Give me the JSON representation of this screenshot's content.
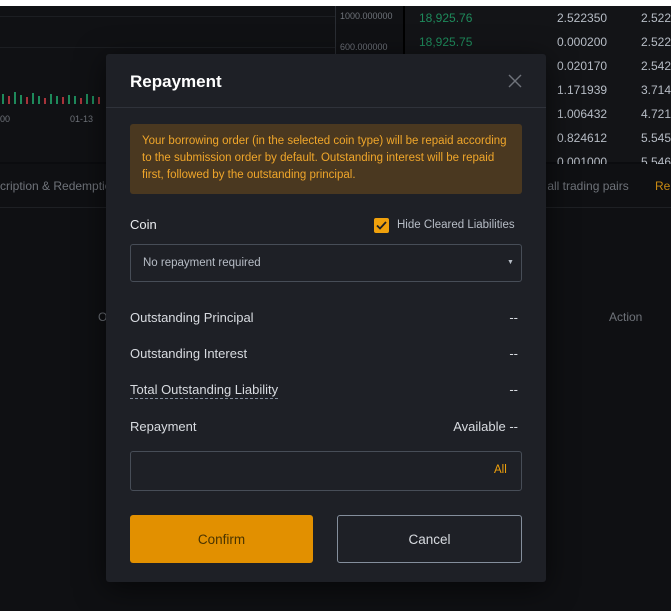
{
  "background": {
    "chart": {
      "y_ticks": [
        "1000.000000",
        "600.000000"
      ],
      "x_ticks": [
        "00",
        "01-13"
      ]
    },
    "orderbook": {
      "rows": [
        {
          "price": "18,925.76",
          "amount": "2.522350",
          "total": "2.522"
        },
        {
          "price": "18,925.75",
          "amount": "0.000200",
          "total": "2.522"
        },
        {
          "price": "",
          "amount": "0.020170",
          "total": "2.542"
        },
        {
          "price": "",
          "amount": "1.171939",
          "total": "3.714"
        },
        {
          "price": "",
          "amount": "1.006432",
          "total": "4.721"
        },
        {
          "price": "",
          "amount": "0.824612",
          "total": "5.545"
        },
        {
          "price": "",
          "amount": "0.001000",
          "total": "5.546"
        }
      ]
    },
    "tabs_left": "cription & Redemptio",
    "tabs_right": "v all trading pairs",
    "tabs_right_accent": "Re",
    "column_left": "O",
    "column_action": "Action"
  },
  "modal": {
    "title": "Repayment",
    "notice": "Your borrowing order (in the selected coin type) will be repaid according to the submission order by default. Outstanding interest will be repaid first, followed by the outstanding principal.",
    "coin_label": "Coin",
    "hide_cleared_label": "Hide Cleared Liabilities",
    "hide_cleared_checked": true,
    "coin_select_value": "No repayment required",
    "outstanding_principal_label": "Outstanding Principal",
    "outstanding_principal_value": "--",
    "outstanding_interest_label": "Outstanding Interest",
    "outstanding_interest_value": "--",
    "total_liability_label": "Total Outstanding Liability",
    "total_liability_value": "--",
    "repayment_label": "Repayment",
    "available_text": "Available --",
    "repay_input_value": "",
    "all_label": "All",
    "confirm_label": "Confirm",
    "cancel_label": "Cancel"
  },
  "colors": {
    "accent": "#f0a10c",
    "confirm_bg": "#e29000",
    "notice_bg": "#4a3820",
    "notice_text": "#f0a62a",
    "modal_bg": "#1e2026"
  },
  "icons": {
    "close": "close-icon",
    "check": "check-icon",
    "caret": "caret-down-icon"
  }
}
